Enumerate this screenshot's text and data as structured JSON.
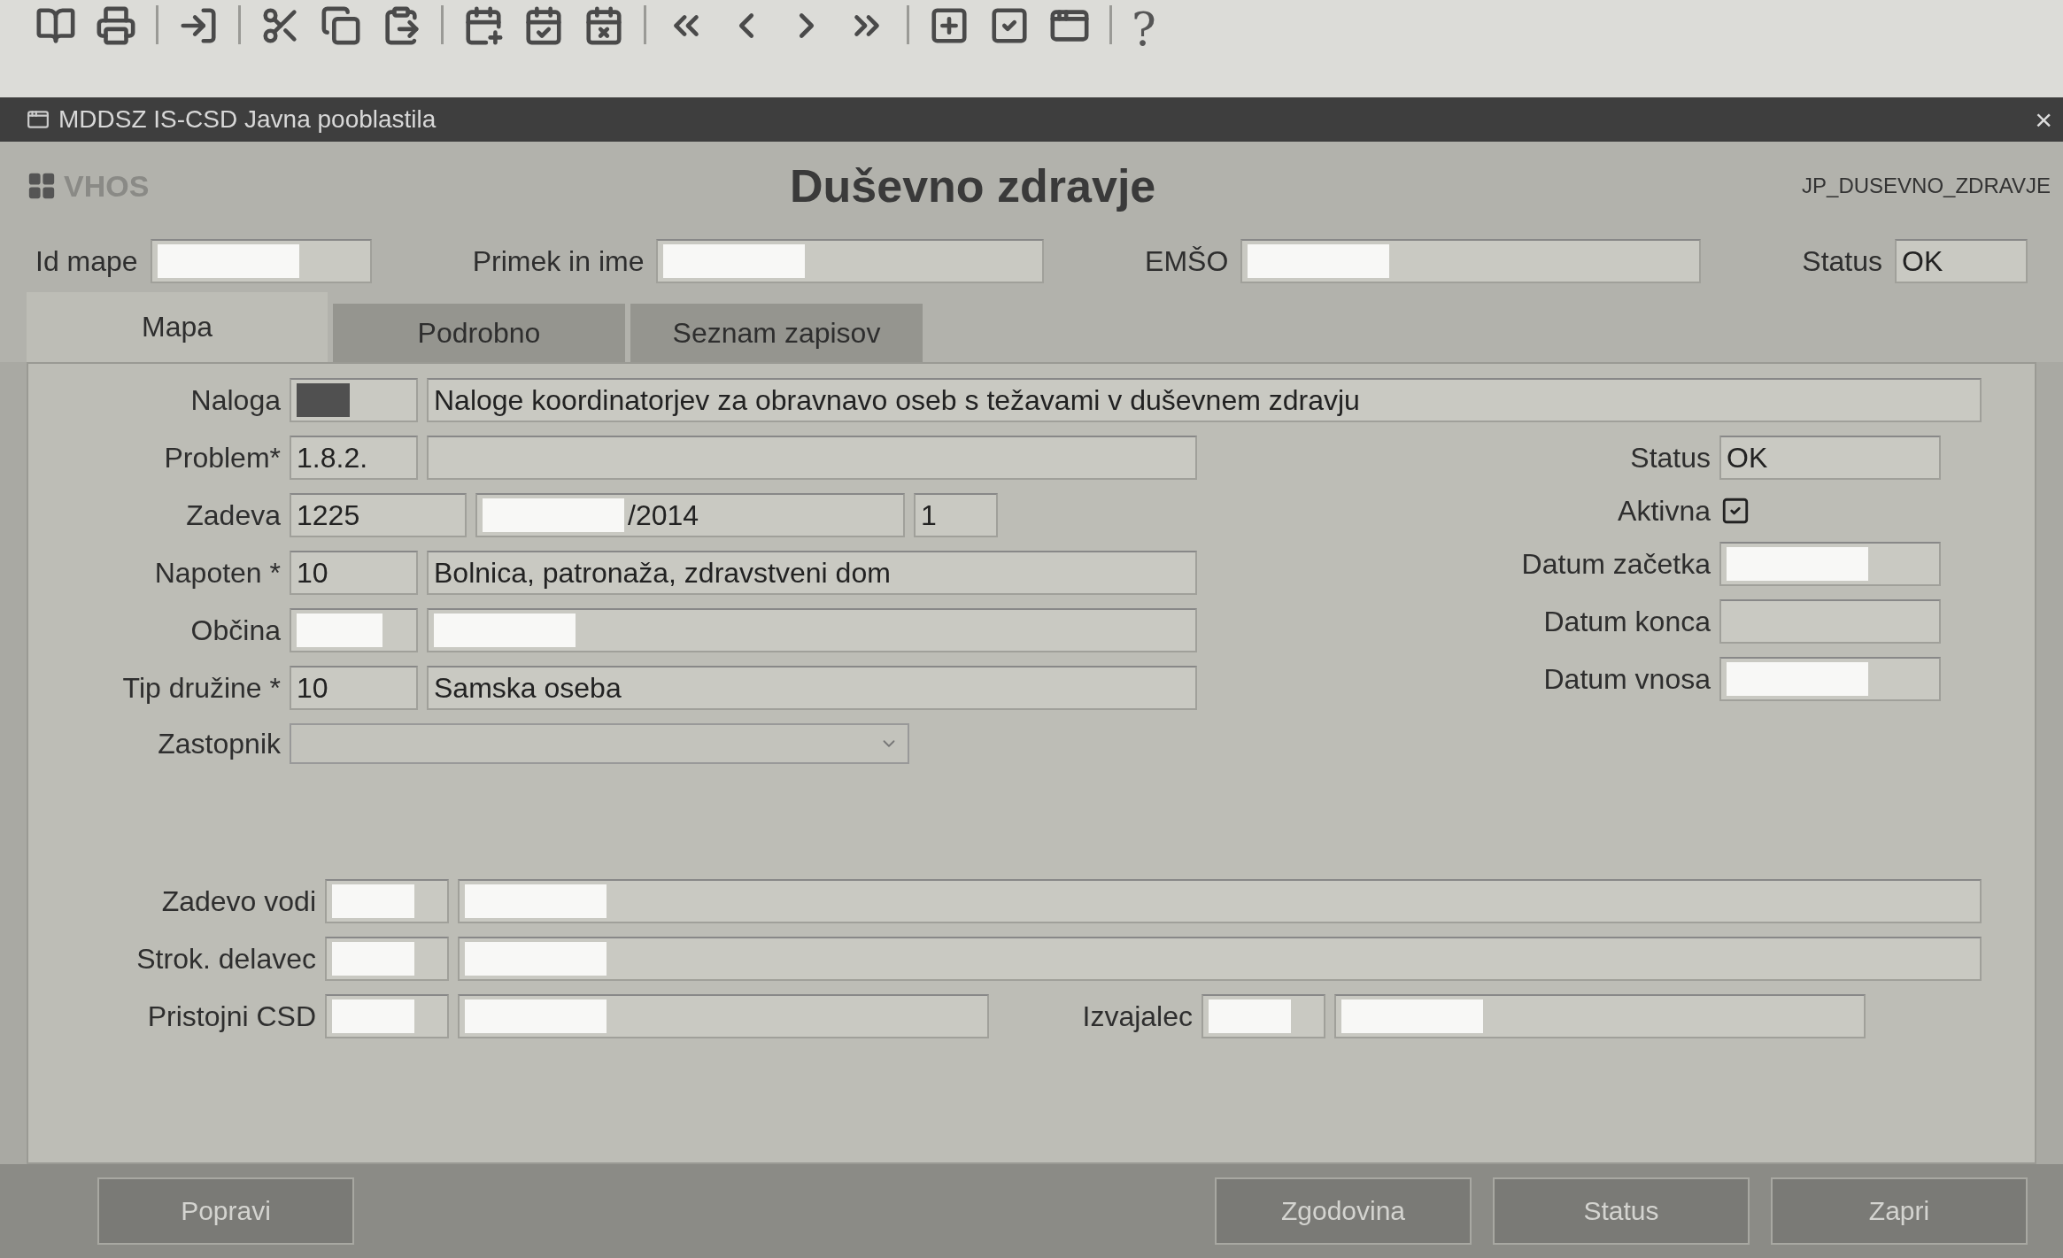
{
  "toolbar": {
    "help": "?"
  },
  "window": {
    "title": "MDDSZ IS-CSD Javna pooblastila",
    "close": "×"
  },
  "header": {
    "module": "VHOS",
    "title": "Duševno zdravje",
    "code": "JP_DUSEVNO_ZDRAVJE"
  },
  "record": [
    {
      "label": "Id mape",
      "redacted": true,
      "kind": "id"
    },
    {
      "label": "Primek in ime",
      "redacted": true,
      "kind": "name"
    },
    {
      "label": "EMŠO",
      "redacted": true,
      "kind": "emso"
    },
    {
      "label": "Status",
      "value": "OK",
      "kind": "status"
    }
  ],
  "tabs": [
    {
      "label": "Mapa",
      "selected": true
    },
    {
      "label": "Podrobno",
      "selected": false
    },
    {
      "label": "Seznam zapisov",
      "selected": false
    }
  ],
  "task": {
    "label": "Naloga",
    "code": {
      "highlighted": true
    },
    "text": "Naloge koordinatorjev za obravnavo oseb s težavami v duševnem zdravju"
  },
  "form": [
    {
      "label": "Problem*",
      "fields": [
        {
          "kind": "code",
          "value": "1.8.2."
        },
        {
          "kind": "text"
        }
      ]
    },
    {
      "label": "Zadeva",
      "fields": [
        {
          "kind": "number",
          "value": "1225"
        },
        {
          "kind": "year",
          "value": "/2014",
          "redacted": true
        },
        {
          "kind": "one",
          "value": "1"
        }
      ]
    },
    {
      "label": "Napoten *",
      "fields": [
        {
          "kind": "code",
          "value": "10"
        },
        {
          "kind": "text",
          "value": "Bolnica, patronaža, zdravstveni dom"
        }
      ]
    },
    {
      "label": "Občina",
      "fields": [
        {
          "kind": "code",
          "redacted": true
        },
        {
          "kind": "text",
          "redacted": true
        }
      ]
    },
    {
      "label": "Tip družine *",
      "fields": [
        {
          "kind": "code",
          "value": "10"
        },
        {
          "kind": "text",
          "value": "Samska oseba"
        }
      ]
    },
    {
      "label": "Zastopnik",
      "fields": [
        {
          "kind": "dropdown"
        }
      ]
    }
  ],
  "side": [
    {
      "label": "Status",
      "kind": "field",
      "value": "OK"
    },
    {
      "label": "Aktivna",
      "kind": "checkbox",
      "checked": true
    },
    {
      "label": "Datum začetka",
      "kind": "field",
      "redacted": true
    },
    {
      "label": "Datum konca",
      "kind": "field"
    },
    {
      "label": "Datum vnosa",
      "kind": "field",
      "redacted": true
    }
  ],
  "people": [
    {
      "groups": [
        {
          "label": "Zadevo vodi",
          "fields": [
            {
              "kind": "small",
              "redacted": true
            },
            {
              "kind": "name",
              "redacted": true
            }
          ]
        }
      ]
    },
    {
      "groups": [
        {
          "label": "Strok. delavec",
          "fields": [
            {
              "kind": "small",
              "redacted": true
            },
            {
              "kind": "name",
              "redacted": true
            }
          ]
        }
      ]
    },
    {
      "groups": [
        {
          "label": "Pristojni CSD",
          "fields": [
            {
              "kind": "small",
              "redacted": true
            },
            {
              "kind": "short",
              "redacted": true
            }
          ]
        },
        {
          "label": "Izvajalec",
          "fields": [
            {
              "kind": "small",
              "redacted": true
            },
            {
              "kind": "short",
              "redacted": true
            }
          ]
        }
      ]
    }
  ],
  "buttons": [
    {
      "label": "Popravi",
      "kind": "left"
    },
    {
      "label": "Zgodovina",
      "kind": "right"
    },
    {
      "label": "Status",
      "kind": "right"
    },
    {
      "label": "Zapri",
      "kind": "right"
    }
  ]
}
